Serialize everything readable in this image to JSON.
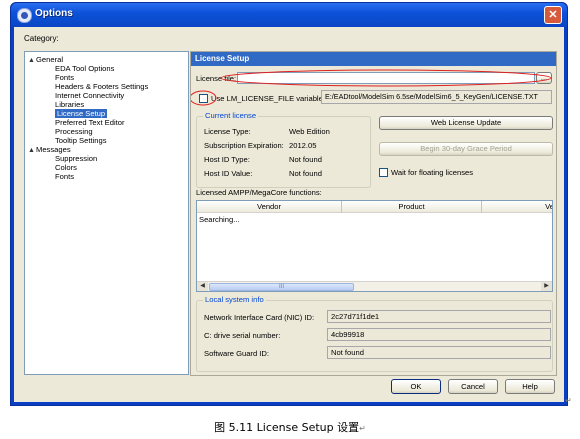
{
  "window": {
    "title": "Options",
    "close_glyph": "✕",
    "icon": "app-icon"
  },
  "category_label": "Category:",
  "tree": [
    {
      "label": "General",
      "level": 0,
      "expanded": true
    },
    {
      "label": "EDA Tool Options",
      "level": 1
    },
    {
      "label": "Fonts",
      "level": 1
    },
    {
      "label": "Headers & Footers Settings",
      "level": 1
    },
    {
      "label": "Internet Connectivity",
      "level": 1
    },
    {
      "label": "Libraries",
      "level": 1
    },
    {
      "label": "License Setup",
      "level": 1,
      "selected": true
    },
    {
      "label": "Preferred Text Editor",
      "level": 1
    },
    {
      "label": "Processing",
      "level": 1
    },
    {
      "label": "Tooltip Settings",
      "level": 1
    },
    {
      "label": "Messages",
      "level": 0,
      "expanded": true
    },
    {
      "label": "Suppression",
      "level": 1
    },
    {
      "label": "Colors",
      "level": 1
    },
    {
      "label": "Fonts",
      "level": 1
    }
  ],
  "license": {
    "header": "License Setup",
    "license_file_label": "License file:",
    "license_file_value": "",
    "browse_label": "...",
    "use_env_label": "Use LM_LICENSE_FILE variable:",
    "use_env_checked": false,
    "env_value": "E:/EADtool/ModelSim 6.5se/ModelSim6_5_KeyGen/LICENSE.TXT",
    "current": {
      "title": "Current license",
      "rows": [
        {
          "k": "License Type:",
          "v": "Web Edition"
        },
        {
          "k": "Subscription Expiration:",
          "v": "2012.05"
        },
        {
          "k": "Host ID Type:",
          "v": "Not found"
        },
        {
          "k": "Host ID Value:",
          "v": "Not found"
        }
      ]
    },
    "web_update_label": "Web License Update",
    "grace_label": "Begin 30-day Grace Period",
    "wait_label": "Wait for floating licenses",
    "ampp_label": "Licensed AMPP/MegaCore functions:",
    "table": {
      "columns": [
        "Vendor",
        "Product",
        "Versi"
      ],
      "status": "Searching...",
      "thumb_grip": "III"
    },
    "local": {
      "title": "Local system info",
      "rows": [
        {
          "k": "Network Interface Card (NIC) ID:",
          "v": "2c27d71f1de1"
        },
        {
          "k": "C: drive serial number:",
          "v": "4cb99918"
        },
        {
          "k": "Software Guard ID:",
          "v": "Not found"
        }
      ]
    }
  },
  "buttons": {
    "ok": "OK",
    "cancel": "Cancel",
    "help": "Help"
  },
  "caption": "图 5.11 License Setup 设置",
  "return_mark": "↵",
  "colors": {
    "selection": "#316ac5",
    "titlebar": "#0c52d9",
    "annotation": "#e02020"
  }
}
